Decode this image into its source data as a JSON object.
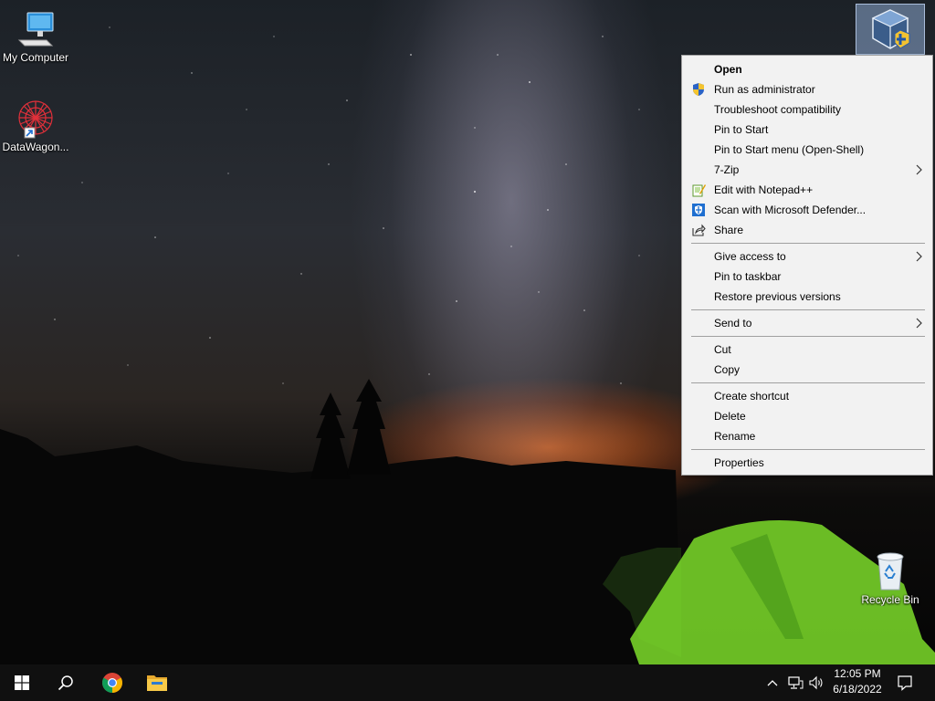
{
  "desktop": {
    "icons": [
      {
        "label": "My Computer",
        "icon": "computer-icon"
      },
      {
        "label": "DataWagon...",
        "icon": "datawagon-shortcut-icon"
      },
      {
        "label": "Recycle Bin",
        "icon": "recycle-bin-icon"
      },
      {
        "label": "",
        "icon": "virtualbox-icon"
      }
    ]
  },
  "context_menu": {
    "items": [
      {
        "label": "Open",
        "bold": true
      },
      {
        "label": "Run as administrator",
        "icon": "uac-shield-icon"
      },
      {
        "label": "Troubleshoot compatibility"
      },
      {
        "label": "Pin to Start"
      },
      {
        "label": "Pin to Start menu (Open-Shell)"
      },
      {
        "label": "7-Zip",
        "submenu": true
      },
      {
        "label": "Edit with Notepad++",
        "icon": "notepad-plus-plus-icon"
      },
      {
        "label": "Scan with Microsoft Defender...",
        "icon": "defender-icon"
      },
      {
        "label": "Share",
        "icon": "share-icon"
      },
      {
        "label": "Give access to",
        "submenu": true
      },
      {
        "label": "Pin to taskbar"
      },
      {
        "label": "Restore previous versions"
      },
      {
        "label": "Send to",
        "submenu": true
      },
      {
        "label": "Cut"
      },
      {
        "label": "Copy"
      },
      {
        "label": "Create shortcut"
      },
      {
        "label": "Delete"
      },
      {
        "label": "Rename"
      },
      {
        "label": "Properties"
      }
    ]
  },
  "taskbar": {
    "start": "windows-start-icon",
    "search": "search-icon",
    "pinned": [
      "chrome-icon",
      "file-explorer-icon"
    ],
    "tray": [
      "chevron-up-icon",
      "network-icon",
      "volume-icon"
    ],
    "clock": {
      "time": "12:05 PM",
      "date": "6/18/2022"
    },
    "notifications": "action-center-icon"
  },
  "colors": {
    "menu_bg": "#f2f2f2",
    "menu_border": "#a0a0a0",
    "taskbar_bg": "#101010",
    "selection": "#8caad2"
  }
}
